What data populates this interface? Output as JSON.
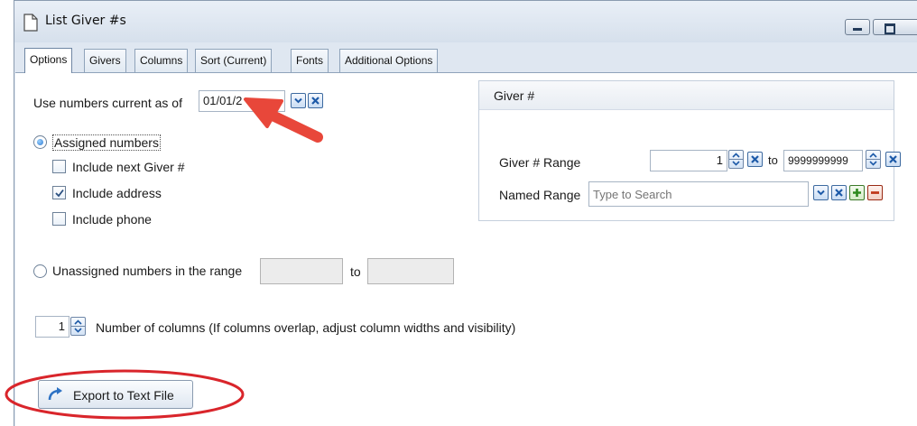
{
  "window": {
    "title": "List Giver #s",
    "minimize_icon": "minimize-icon",
    "maximize_icon": "maximize-icon"
  },
  "tabs": [
    {
      "label": "Options",
      "active": true
    },
    {
      "label": "Givers"
    },
    {
      "label": "Columns"
    },
    {
      "label": "Sort (Current)"
    },
    {
      "label": "Fonts"
    },
    {
      "label": "Additional Options"
    }
  ],
  "options": {
    "current_as_of_label": "Use numbers current as of",
    "current_as_of_value": "01/01/2",
    "assigned_label": "Assigned numbers",
    "assigned_selected": true,
    "include_next_label": "Include next Giver #",
    "include_next_checked": false,
    "include_address_label": "Include address",
    "include_address_checked": true,
    "include_phone_label": "Include phone",
    "include_phone_checked": false,
    "unassigned_label": "Unassigned numbers in the range",
    "unassigned_selected": false,
    "unassigned_to_label": "to",
    "unassigned_from_value": "",
    "unassigned_to_value": "",
    "columns_value": "1",
    "columns_label": "Number of columns   (If columns overlap, adjust column widths and visibility)",
    "export_label": "Export to Text File"
  },
  "giver_panel": {
    "header": "Giver #",
    "range_label": "Giver # Range",
    "range_from": "1",
    "range_to_label": "to",
    "range_to": "9999999999",
    "named_range_label": "Named Range",
    "named_range_placeholder": "Type to Search"
  },
  "annotations": {
    "arrow_color": "#e8473a",
    "circle_color": "#d9252b"
  }
}
